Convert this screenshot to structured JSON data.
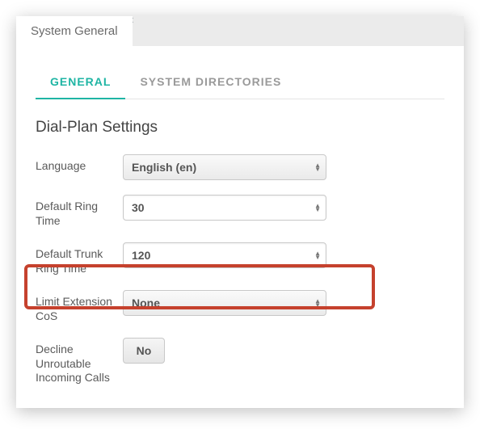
{
  "header": {
    "tab_label": "System General"
  },
  "tabs": {
    "general": "GENERAL",
    "directories": "SYSTEM DIRECTORIES"
  },
  "section": {
    "title": "Dial-Plan Settings"
  },
  "fields": {
    "language": {
      "label": "Language",
      "value": "English (en)"
    },
    "default_ring": {
      "label": "Default Ring Time",
      "value": "30"
    },
    "trunk_ring": {
      "label": "Default Trunk Ring Time",
      "value": "120"
    },
    "limit_cos": {
      "label": "Limit Extension CoS",
      "value": "None"
    },
    "decline": {
      "label": "Decline Unroutable Incoming Calls",
      "value": "No"
    }
  }
}
